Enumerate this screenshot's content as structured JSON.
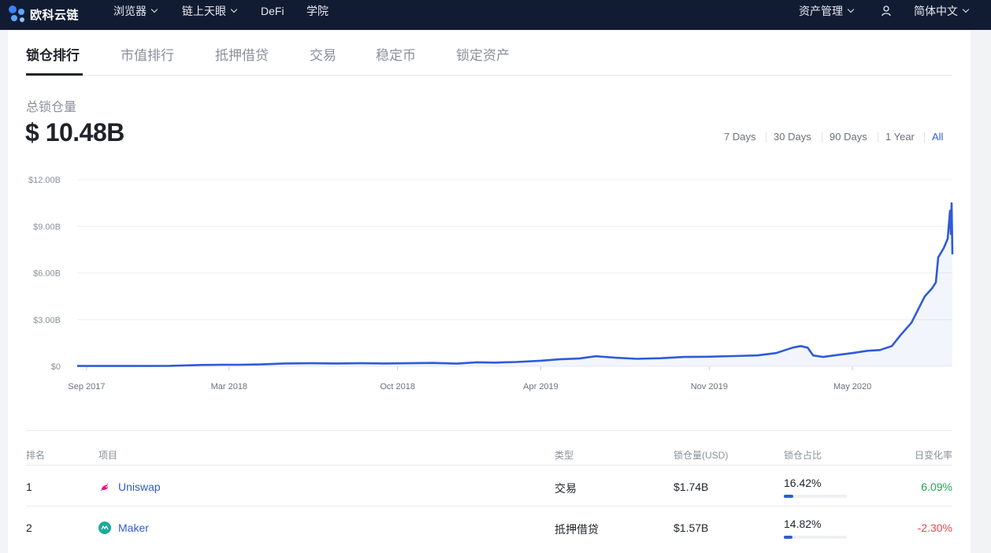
{
  "nav": {
    "logo_text": "欧科云链",
    "items": [
      {
        "label": "浏览器",
        "dropdown": true
      },
      {
        "label": "链上天眼",
        "dropdown": true
      },
      {
        "label": "DeFi",
        "dropdown": false
      },
      {
        "label": "学院",
        "dropdown": false
      }
    ],
    "asset_mgmt": "资产管理",
    "language": "简体中文"
  },
  "tabs": [
    "锁仓排行",
    "市值排行",
    "抵押借贷",
    "交易",
    "稳定币",
    "锁定资产"
  ],
  "active_tab": "锁仓排行",
  "tvl": {
    "label": "总锁仓量",
    "value": "$ 10.48B"
  },
  "ranges": [
    "7 Days",
    "30 Days",
    "90 Days",
    "1 Year",
    "All"
  ],
  "active_range": "All",
  "colors": {
    "topbar": "#111c33",
    "accent": "#2f5bd6",
    "positive": "#22a552",
    "negative": "#e5484d"
  },
  "chart_data": {
    "type": "line",
    "yticks": [
      "$12.00B",
      "$9.00B",
      "$6.00B",
      "$3.00B",
      "$0"
    ],
    "xticks": [
      "Sep 2017",
      "Mar 2018",
      "Oct 2018",
      "Apr 2019",
      "Nov 2019",
      "May 2020"
    ],
    "ylim": [
      0,
      12
    ],
    "yunit": "B USD",
    "grid": true,
    "series": [
      {
        "points": [
          [
            "2017-08-20",
            0.02
          ],
          [
            "2017-09-15",
            0.02
          ],
          [
            "2017-11-01",
            0.02
          ],
          [
            "2017-12-15",
            0.03
          ],
          [
            "2018-01-20",
            0.08
          ],
          [
            "2018-02-20",
            0.1
          ],
          [
            "2018-03-15",
            0.1
          ],
          [
            "2018-04-10",
            0.12
          ],
          [
            "2018-05-10",
            0.18
          ],
          [
            "2018-06-15",
            0.2
          ],
          [
            "2018-07-15",
            0.18
          ],
          [
            "2018-08-15",
            0.2
          ],
          [
            "2018-09-15",
            0.18
          ],
          [
            "2018-10-15",
            0.2
          ],
          [
            "2018-11-15",
            0.22
          ],
          [
            "2018-12-15",
            0.17
          ],
          [
            "2019-01-10",
            0.26
          ],
          [
            "2019-02-01",
            0.24
          ],
          [
            "2019-03-01",
            0.28
          ],
          [
            "2019-04-01",
            0.36
          ],
          [
            "2019-04-25",
            0.45
          ],
          [
            "2019-05-20",
            0.5
          ],
          [
            "2019-06-10",
            0.65
          ],
          [
            "2019-07-05",
            0.55
          ],
          [
            "2019-08-01",
            0.48
          ],
          [
            "2019-09-01",
            0.52
          ],
          [
            "2019-10-01",
            0.6
          ],
          [
            "2019-11-01",
            0.62
          ],
          [
            "2019-12-01",
            0.66
          ],
          [
            "2020-01-01",
            0.7
          ],
          [
            "2020-01-25",
            0.85
          ],
          [
            "2020-02-15",
            1.2
          ],
          [
            "2020-02-25",
            1.3
          ],
          [
            "2020-03-05",
            1.2
          ],
          [
            "2020-03-12",
            0.7
          ],
          [
            "2020-03-25",
            0.6
          ],
          [
            "2020-04-15",
            0.75
          ],
          [
            "2020-05-01",
            0.85
          ],
          [
            "2020-05-20",
            1.0
          ],
          [
            "2020-06-05",
            1.05
          ],
          [
            "2020-06-20",
            1.3
          ],
          [
            "2020-07-01",
            2.0
          ],
          [
            "2020-07-15",
            2.8
          ],
          [
            "2020-07-25",
            3.8
          ],
          [
            "2020-08-01",
            4.5
          ],
          [
            "2020-08-10",
            5.0
          ],
          [
            "2020-08-15",
            5.4
          ],
          [
            "2020-08-18",
            7.0
          ],
          [
            "2020-08-25",
            7.6
          ],
          [
            "2020-08-30",
            8.2
          ],
          [
            "2020-09-02",
            10.0
          ],
          [
            "2020-09-03",
            8.5
          ],
          [
            "2020-09-04",
            10.48
          ],
          [
            "2020-09-05",
            7.2
          ]
        ]
      }
    ]
  },
  "table": {
    "headers": [
      "排名",
      "项目",
      "类型",
      "锁仓量(USD)",
      "锁仓占比",
      "日变化率"
    ],
    "rows": [
      {
        "rank": "1",
        "name": "Uniswap",
        "icon": "uniswap-unicorn-icon",
        "type": "交易",
        "tvl": "$1.74B",
        "share": "16.42%",
        "share_pct": 16.42,
        "change": "6.09%",
        "change_dir": "pos"
      },
      {
        "rank": "2",
        "name": "Maker",
        "icon": "maker-icon",
        "type": "抵押借贷",
        "tvl": "$1.57B",
        "share": "14.82%",
        "share_pct": 14.82,
        "change": "-2.30%",
        "change_dir": "neg"
      }
    ]
  }
}
